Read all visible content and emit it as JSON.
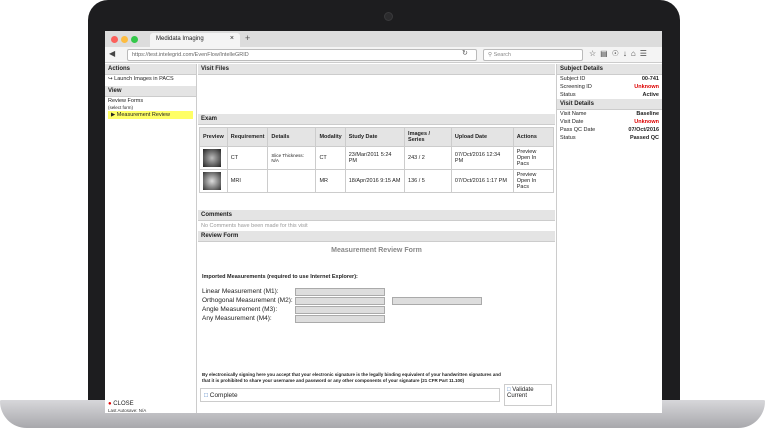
{
  "browser": {
    "tab_title": "Medidata Imaging",
    "tab_close": "×",
    "new_tab": "+",
    "url": "https://test.intelegrid.com/EvenFlow/IntelleGRID",
    "search_placeholder": "Search"
  },
  "left": {
    "actions_header": "Actions",
    "launch": "Launch Images in PACS",
    "view_header": "View",
    "review_forms": "Review Forms",
    "select_form": "(select form)",
    "measurement_review": "Measurement Review",
    "close": "CLOSE",
    "autosave": "Last Autosave: N/A"
  },
  "main": {
    "visit_files": "Visit Files",
    "exam": "Exam",
    "columns": [
      "Preview",
      "Requirement",
      "Details",
      "Modality",
      "Study Date",
      "Images / Series",
      "Upload Date",
      "Actions"
    ],
    "rows": [
      {
        "requirement": "CT",
        "details": "Slice Thickness: N/A",
        "modality": "CT",
        "study_date": "23/Mar/2011 5:24 PM",
        "images": "243 / 2",
        "upload": "07/Oct/2016 12:34 PM",
        "action1": "Preview",
        "action2": "Open In Pacs"
      },
      {
        "requirement": "MRI",
        "details": "",
        "modality": "MR",
        "study_date": "18/Apr/2016 9:15 AM",
        "images": "136 / 5",
        "upload": "07/Oct/2016 1:17 PM",
        "action1": "Preview",
        "action2": "Open In Pacs"
      }
    ],
    "comments_header": "Comments",
    "no_comments": "No Comments have been made for this visit",
    "review_form_header": "Review Form",
    "form_title": "Measurement Review Form",
    "imported": "Imported Measurements (required to use Internet Explorer):",
    "m1": "Linear Measurement (M1):",
    "m2": "Orthogonal Measurement (M2):",
    "m3": "Angle Measurement (M3):",
    "m4": "Any Measurement (M4):",
    "legal": "By electronically signing here you accept that your electronic signature is the legally binding equivalent of your handwritten signatures and that it is prohibited to share your username and password or any other components of your signature (21 CFR Part 11.100)",
    "complete": "Complete",
    "validate": "Validate Current"
  },
  "right": {
    "subject_header": "Subject Details",
    "subject_id_label": "Subject ID",
    "subject_id": "00-741",
    "screening_label": "Screening ID",
    "screening": "Unknown",
    "status_label": "Status",
    "status": "Active",
    "visit_header": "Visit Details",
    "visit_name_label": "Visit Name",
    "visit_name": "Baseline",
    "visit_date_label": "Visit Date",
    "visit_date": "Unknown",
    "pass_qc_label": "Pass QC Date",
    "pass_qc": "07/Oct/2016",
    "vstatus_label": "Status",
    "vstatus": "Passed QC"
  }
}
